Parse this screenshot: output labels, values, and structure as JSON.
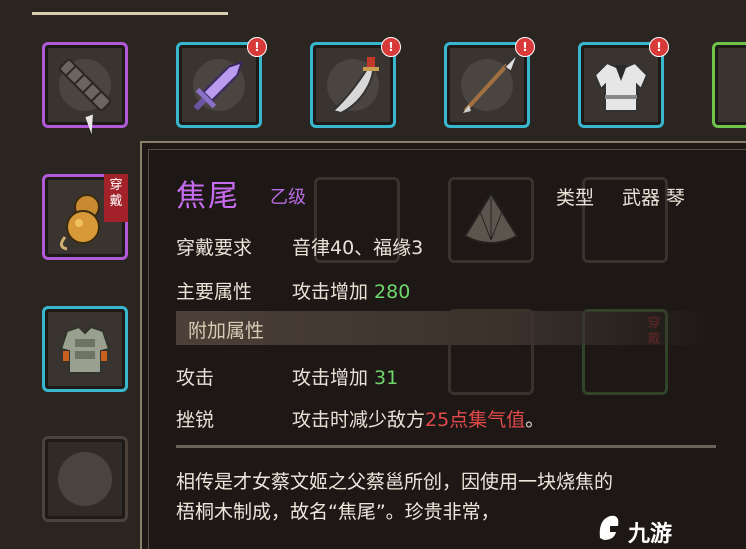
{
  "slots_row1": [
    {
      "id": "bundle",
      "color": "purple",
      "alert": false
    },
    {
      "id": "purple-sword",
      "color": "cyan",
      "alert": true,
      "alert_text": "!"
    },
    {
      "id": "broadsword",
      "color": "cyan",
      "alert": true,
      "alert_text": "!"
    },
    {
      "id": "spear",
      "color": "cyan",
      "alert": true,
      "alert_text": "!"
    },
    {
      "id": "robe",
      "color": "cyan",
      "alert": true,
      "alert_text": "!"
    },
    {
      "id": "partial",
      "color": "green",
      "alert": false
    }
  ],
  "worn_tag": "穿戴",
  "ghost_worn_tag": "穿戴",
  "tooltip": {
    "name": "焦尾",
    "grade": "乙级",
    "type_label": "类型",
    "type_value": "武器 琴",
    "requirement_label": "穿戴要求",
    "requirement_value": "音律40、福缘3",
    "main_attr_label": "主要属性",
    "main_attr_text": "攻击增加 ",
    "main_attr_num": "280",
    "extra_section": "附加属性",
    "attack_label": "攻击",
    "attack_text": "攻击增加 ",
    "attack_num": "31",
    "sharp_label": "挫锐",
    "sharp_text_a": "攻击时减少敌方",
    "sharp_text_red": "25点集气值",
    "sharp_text_b": "。",
    "description_line1": "相传是才女蔡文姬之父蔡邕所创，因使用一块烧焦的",
    "description_line2": "梧桐木制成，故名“焦尾”。珍贵非常，"
  },
  "watermark": "九游",
  "colors": {
    "purple": "#b05ad8",
    "cyan": "#38b8d0",
    "green": "#6fc24a",
    "red": "#e04a4a",
    "num_green": "#6fd66a"
  }
}
